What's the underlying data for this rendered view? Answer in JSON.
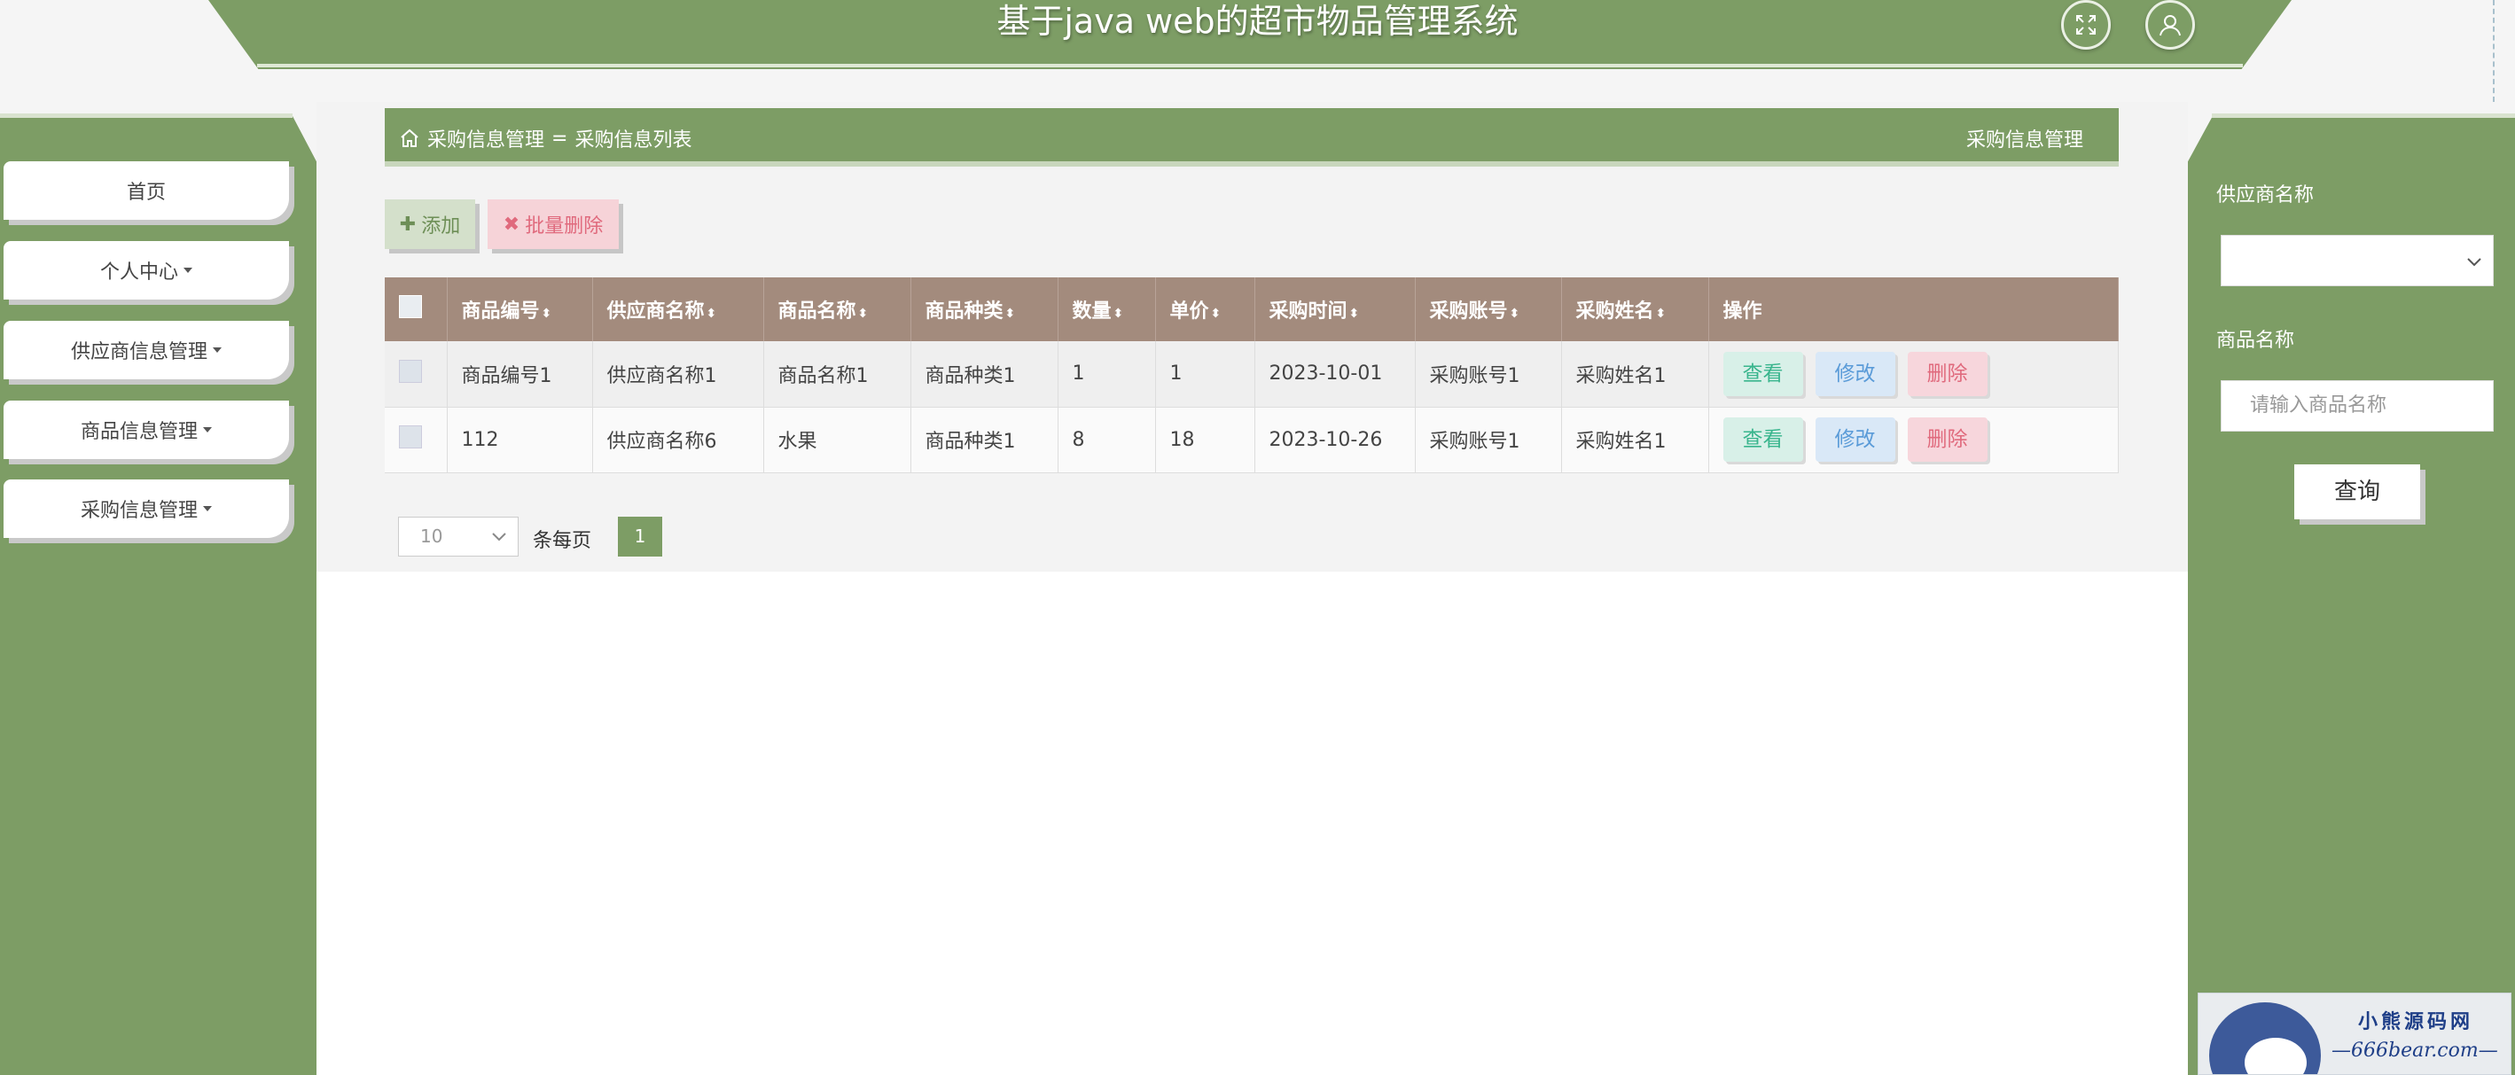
{
  "app": {
    "title": "基于java web的超市物品管理系统"
  },
  "header": {
    "fullscreen_icon": "expand-arrows-icon",
    "user_icon": "user-icon"
  },
  "sidebar": {
    "items": [
      {
        "label": "首页",
        "has_caret": false
      },
      {
        "label": "个人中心",
        "has_caret": true
      },
      {
        "label": "供应商信息管理",
        "has_caret": true
      },
      {
        "label": "商品信息管理",
        "has_caret": true
      },
      {
        "label": "采购信息管理",
        "has_caret": true
      }
    ]
  },
  "breadcrumb": {
    "section": "采购信息管理",
    "separator": "=",
    "page": "采购信息列表",
    "right_title": "采购信息管理"
  },
  "toolbar": {
    "add_label": "添加",
    "batch_delete_label": "批量删除"
  },
  "table": {
    "columns": [
      "商品编号",
      "供应商名称",
      "商品名称",
      "商品种类",
      "数量",
      "单价",
      "采购时间",
      "采购账号",
      "采购姓名",
      "操作"
    ],
    "rows": [
      [
        "商品编号1",
        "供应商名称1",
        "商品名称1",
        "商品种类1",
        "1",
        "1",
        "2023-10-01",
        "采购账号1",
        "采购姓名1"
      ],
      [
        "112",
        "供应商名称6",
        "水果",
        "商品种类1",
        "8",
        "18",
        "2023-10-26",
        "采购账号1",
        "采购姓名1"
      ]
    ],
    "actions": {
      "view": "查看",
      "edit": "修改",
      "delete": "删除"
    }
  },
  "pager": {
    "page_size": "10",
    "per_page_label": "条每页",
    "current_page": "1"
  },
  "search": {
    "supplier_label": "供应商名称",
    "supplier_value": "",
    "product_label": "商品名称",
    "product_placeholder": "请输入商品名称",
    "query_label": "查询"
  },
  "watermark": {
    "line1": "小熊源码网",
    "line2": "—666bear.com—"
  },
  "colors": {
    "primary": "#7d9d65",
    "table_header": "#a38b7d",
    "danger": "#e06a7d",
    "info": "#5a9bd8",
    "success": "#39b58d"
  }
}
